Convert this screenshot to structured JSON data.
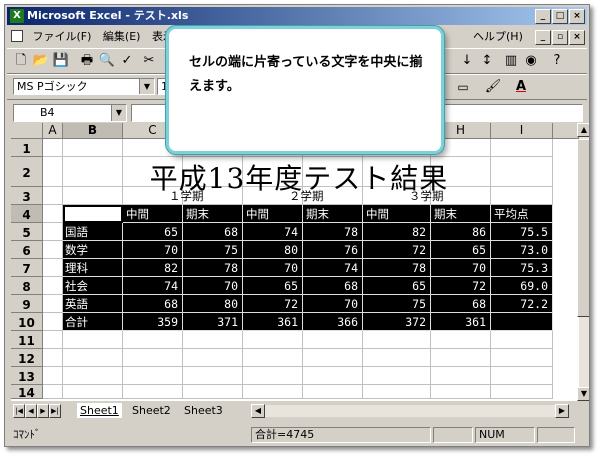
{
  "window": {
    "title": "Microsoft Excel - テスト.xls",
    "controls": {
      "minimize": "_",
      "maximize": "□",
      "close": "×"
    }
  },
  "menu": {
    "items": [
      "ファイル(F)",
      "編集(E)",
      "表示",
      "ヘルプ(H)"
    ],
    "doc_controls": {
      "minimize": "_",
      "restore": "▫",
      "close": "×"
    }
  },
  "format": {
    "font_name": "MS Pゴシック",
    "font_size": "11"
  },
  "formula_bar": {
    "name_box": "B4",
    "content": ""
  },
  "columns": [
    "A",
    "B",
    "C",
    "H",
    "I"
  ],
  "rows": [
    "1",
    "2",
    "3",
    "4",
    "5",
    "6",
    "7",
    "8",
    "9",
    "10",
    "11",
    "12",
    "13",
    "14"
  ],
  "sheet": {
    "title": "平成13年度テスト結果",
    "terms": [
      "１学期",
      "２学期",
      "３学期"
    ],
    "headers": [
      "",
      "中間",
      "期末",
      "中間",
      "期末",
      "中間",
      "期末",
      "平均点"
    ],
    "data": [
      [
        "国語",
        "65",
        "68",
        "74",
        "78",
        "82",
        "86",
        "75.5"
      ],
      [
        "数学",
        "70",
        "75",
        "80",
        "76",
        "72",
        "65",
        "73.0"
      ],
      [
        "理科",
        "82",
        "78",
        "70",
        "74",
        "78",
        "70",
        "75.3"
      ],
      [
        "社会",
        "74",
        "70",
        "65",
        "68",
        "65",
        "72",
        "69.0"
      ],
      [
        "英語",
        "68",
        "80",
        "72",
        "70",
        "75",
        "68",
        "72.2"
      ],
      [
        "合計",
        "359",
        "371",
        "361",
        "366",
        "372",
        "361",
        ""
      ]
    ]
  },
  "tabs": [
    "Sheet1",
    "Sheet2",
    "Sheet3"
  ],
  "status": {
    "mode": "ｺﾏﾝﾄﾞ",
    "sum": "合計=4745",
    "num": "NUM"
  },
  "callout": {
    "text": "セルの端に片寄っている文字を中央に揃えます。"
  }
}
